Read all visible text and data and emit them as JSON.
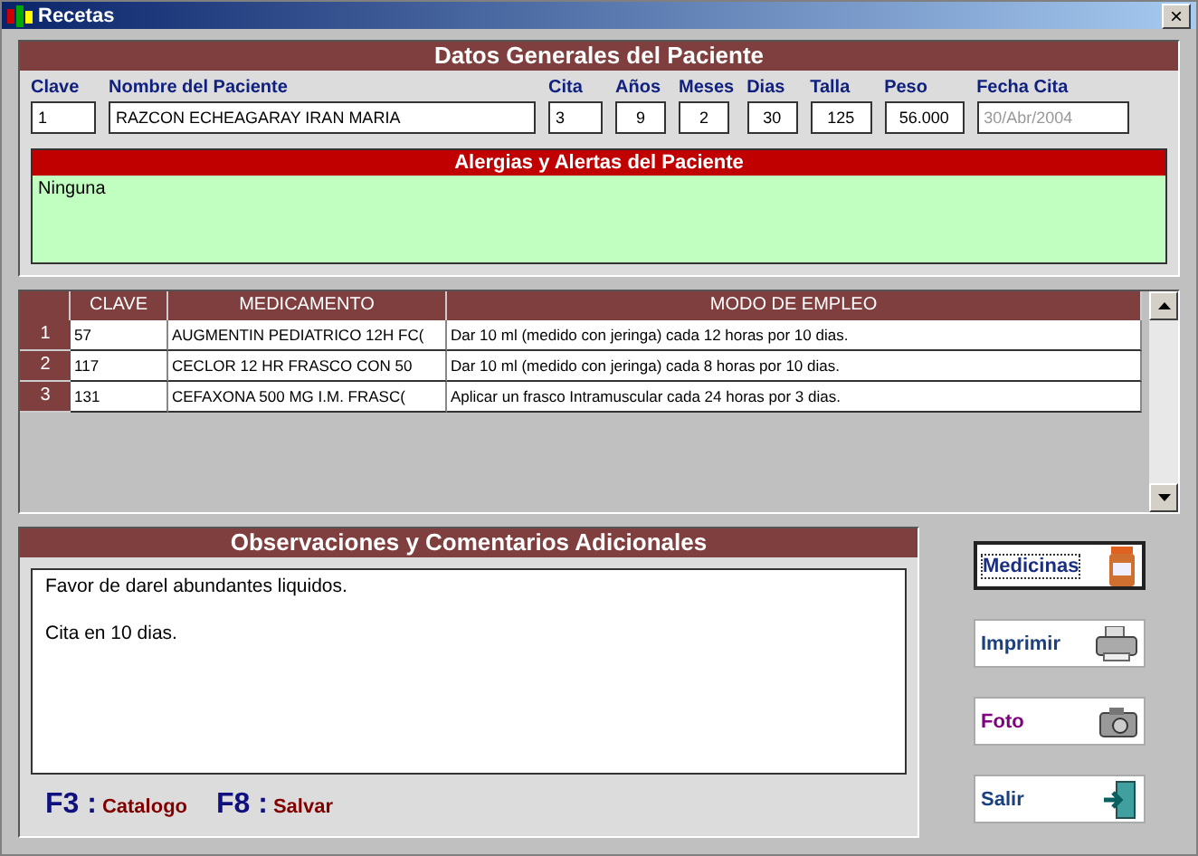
{
  "window": {
    "title": "Recetas",
    "close": "×"
  },
  "patient": {
    "title": "Datos Generales del Paciente",
    "fields": [
      {
        "label": "Clave",
        "value": "1",
        "disabled": false
      },
      {
        "label": "Nombre del Paciente",
        "value": "RAZCON ECHEAGARAY IRAN MARIA",
        "disabled": false
      },
      {
        "label": "Cita",
        "value": "3",
        "disabled": false
      },
      {
        "label": "Años",
        "value": "9",
        "disabled": false
      },
      {
        "label": "Meses",
        "value": "2",
        "disabled": false
      },
      {
        "label": "Dias",
        "value": "30",
        "disabled": false
      },
      {
        "label": "Talla",
        "value": "125",
        "disabled": false
      },
      {
        "label": "Peso",
        "value": "56.000",
        "disabled": false
      },
      {
        "label": "Fecha Cita",
        "value": "30/Abr/2004",
        "disabled": true
      }
    ],
    "alerts": {
      "title": "Alergias y Alertas del Paciente",
      "text": "Ninguna"
    }
  },
  "table": {
    "columns": [
      "CLAVE",
      "MEDICAMENTO",
      "MODO DE EMPLEO"
    ],
    "rows": [
      {
        "number": "1",
        "cells": [
          "57",
          "AUGMENTIN PEDIATRICO 12H FC(",
          "Dar 10 ml (medido con jeringa) cada 12 horas por 10 dias."
        ]
      },
      {
        "number": "2",
        "cells": [
          "117",
          "CECLOR 12 HR FRASCO CON 50",
          "Dar 10 ml (medido con jeringa) cada 8 horas por 10 dias."
        ]
      },
      {
        "number": "3",
        "cells": [
          "131",
          "CEFAXONA  500 MG  I.M. FRASC(",
          "Aplicar un frasco Intramuscular cada 24 horas por 3 dias."
        ]
      }
    ]
  },
  "observations": {
    "title": "Observaciones y Comentarios Adicionales",
    "lines": [
      "Favor de darel abundantes liquidos.",
      "Cita en 10 dias."
    ]
  },
  "shortcuts": [
    {
      "key": "F3 :",
      "action": "Catalogo"
    },
    {
      "key": "F8 :",
      "action": "Salvar"
    }
  ],
  "buttons": [
    {
      "label": "Medicinas",
      "kind": "bottle",
      "color": "#1a2f80",
      "focused": true
    },
    {
      "label": "Imprimir",
      "kind": "printer",
      "color": "#1a4080",
      "focused": false
    },
    {
      "label": "Foto",
      "kind": "camera",
      "color": "#800080",
      "focused": false
    },
    {
      "label": "Salir",
      "kind": "exit",
      "color": "#1a4080",
      "focused": false
    }
  ]
}
